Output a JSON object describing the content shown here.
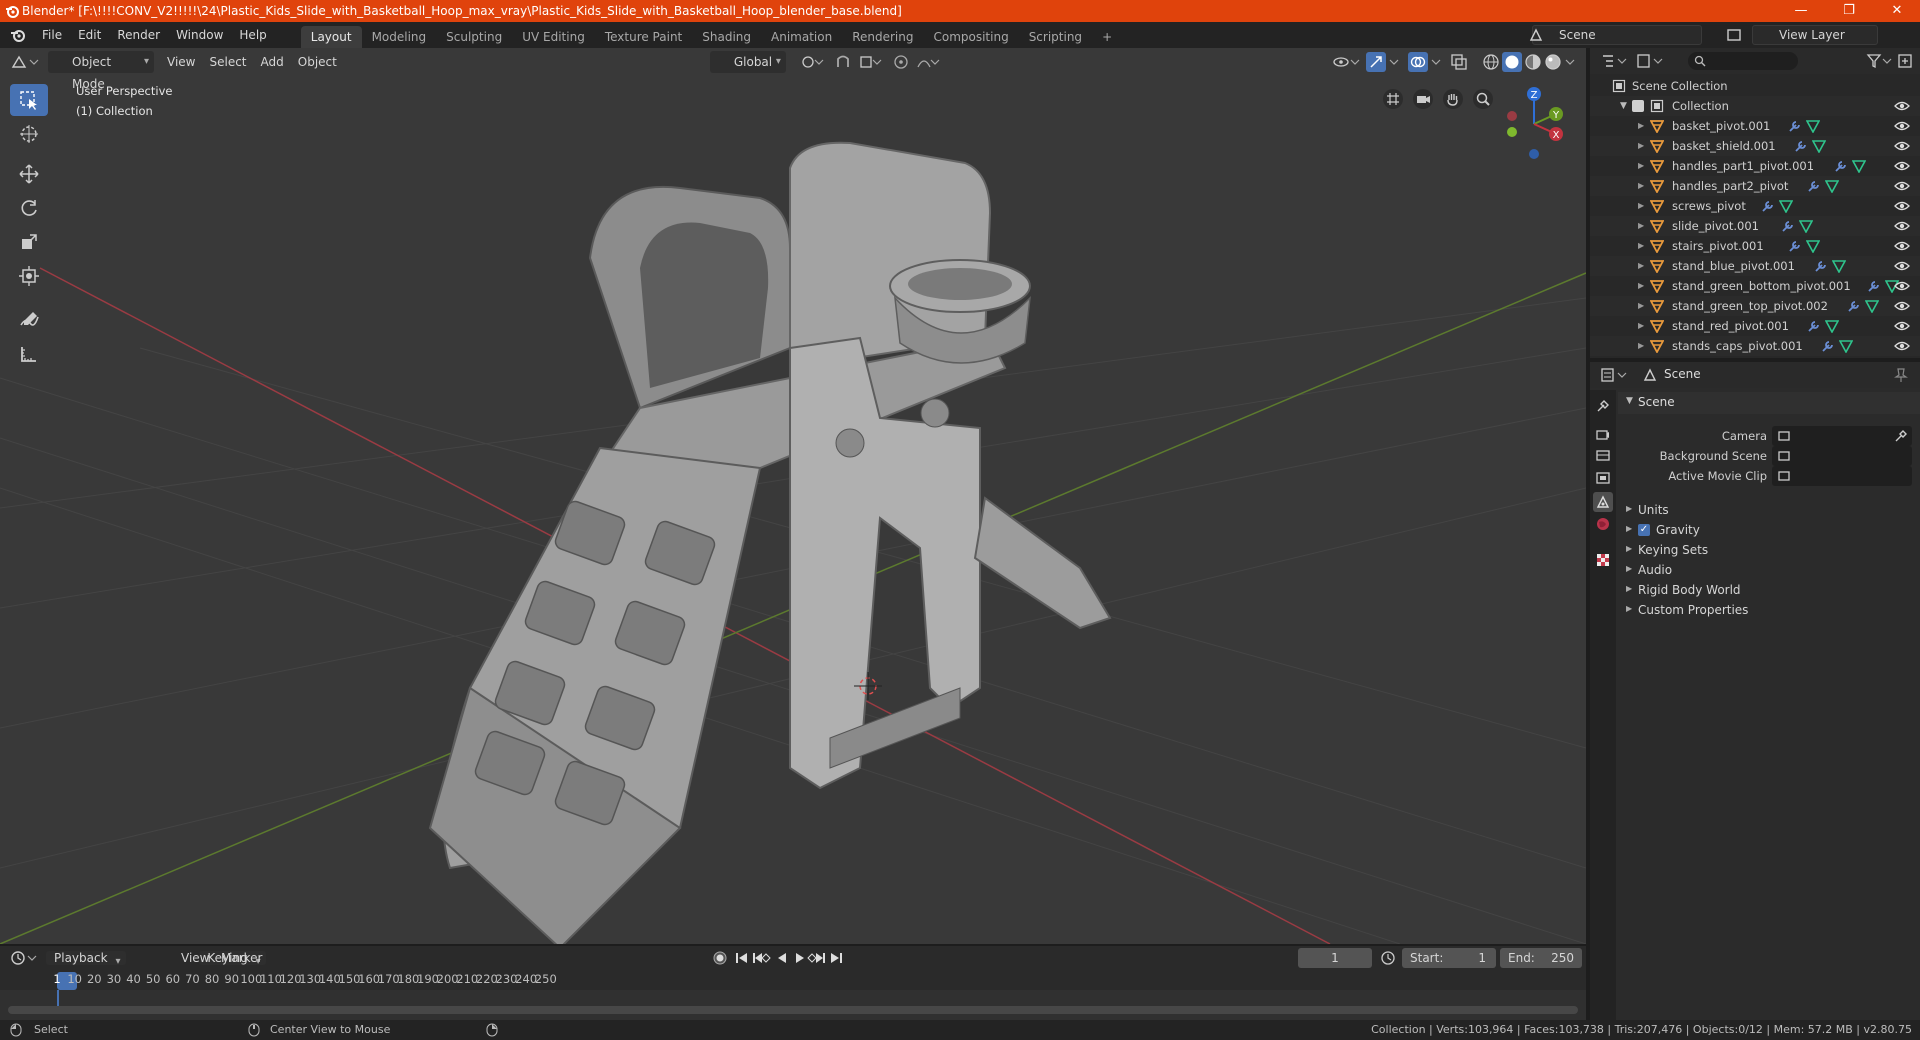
{
  "window": {
    "title": "Blender* [F:\\!!!!CONV_V2!!!!!\\24\\Plastic_Kids_Slide_with_Basketball_Hoop_max_vray\\Plastic_Kids_Slide_with_Basketball_Hoop_blender_base.blend]",
    "minimize": "—",
    "maximize": "❐",
    "close": "✕"
  },
  "menu": [
    "File",
    "Edit",
    "Render",
    "Window",
    "Help"
  ],
  "workspaces": [
    "Layout",
    "Modeling",
    "Sculpting",
    "UV Editing",
    "Texture Paint",
    "Shading",
    "Animation",
    "Rendering",
    "Compositing",
    "Scripting"
  ],
  "workspace_add": "+",
  "scene_field": "Scene",
  "view_layer_field": "View Layer",
  "viewport": {
    "mode": "Object Mode",
    "menus": [
      "View",
      "Select",
      "Add",
      "Object"
    ],
    "transform_orientation": "Global",
    "overlay_line1": "User Perspective",
    "overlay_line2": "(1) Collection",
    "gizmo": {
      "x": "X",
      "y": "Y",
      "z": "Z"
    }
  },
  "outliner": {
    "root": "Scene Collection",
    "collection": "Collection",
    "items": [
      "basket_pivot.001",
      "basket_shield.001",
      "handles_part1_pivot.001",
      "handles_part2_pivot",
      "screws_pivot",
      "slide_pivot.001",
      "stairs_pivot.001",
      "stand_blue_pivot.001",
      "stand_green_bottom_pivot.001",
      "stand_green_top_pivot.002",
      "stand_red_pivot.001",
      "stands_caps_pivot.001"
    ]
  },
  "properties": {
    "header": "Scene",
    "section": "Scene",
    "rows": [
      {
        "label": "Camera",
        "value": ""
      },
      {
        "label": "Background Scene",
        "value": ""
      },
      {
        "label": "Active Movie Clip",
        "value": ""
      }
    ],
    "subpanels": [
      "Units",
      "Gravity",
      "Keying Sets",
      "Audio",
      "Rigid Body World",
      "Custom Properties"
    ],
    "gravity_checked": true
  },
  "timeline": {
    "menus": [
      "Playback",
      "Keying",
      "View",
      "Marker"
    ],
    "current_frame": "1",
    "start_label": "Start:",
    "start": "1",
    "end_label": "End:",
    "end": "250",
    "ruler": [
      "1",
      "10",
      "20",
      "30",
      "40",
      "50",
      "60",
      "70",
      "80",
      "90",
      "100",
      "110",
      "120",
      "130",
      "140",
      "150",
      "160",
      "170",
      "180",
      "190",
      "200",
      "210",
      "220",
      "230",
      "240",
      "250"
    ]
  },
  "status": {
    "left_action": "Select",
    "mid_action": "Center View to Mouse",
    "stats": "Collection | Verts:103,964 | Faces:103,738 | Tris:207,476 | Objects:0/12 | Mem: 57.2 MB | v2.80.75"
  },
  "colors": {
    "accent": "#4772b3",
    "titlebar": "#e0430c",
    "axis_x": "#c2333f",
    "axis_y": "#6a9a22",
    "axis_z": "#2f6fd6",
    "mesh_icon": "#e99a3c",
    "modifier_icon": "#6b8fd6",
    "data_icon": "#2fc48d"
  }
}
